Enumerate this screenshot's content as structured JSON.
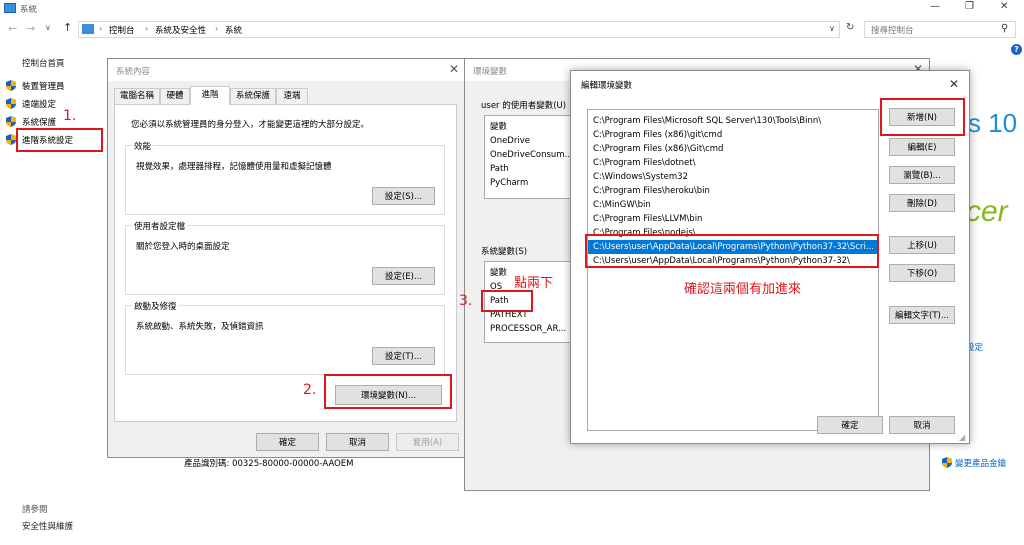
{
  "window": {
    "title": "系統",
    "controls": [
      "—",
      "❐",
      "✕"
    ]
  },
  "address": {
    "breadcrumbs": [
      "控制台",
      "系統及安全性",
      "系統"
    ],
    "search_placeholder": "搜尋控制台"
  },
  "sidebar": {
    "home": "控制台首頁",
    "items": [
      "裝置管理員",
      "遠端設定",
      "系統保護",
      "進階系統設定"
    ],
    "see_also": "請參閱",
    "bottom_link": "安全性與維護"
  },
  "main": {
    "product_id": "產品識別碼: 00325-80000-00000-AAOEM",
    "change_key": "變更產品金鑰",
    "fragment_settings": "設定",
    "fragment_logo1": "s 10",
    "fragment_logo2": "cer",
    "help_icon": "?"
  },
  "sys_props": {
    "title": "系統內容",
    "tabs": [
      "電腦名稱",
      "硬體",
      "進階",
      "系統保護",
      "遠端"
    ],
    "admin_notice": "您必須以系統管理員的身分登入，才能變更這裡的大部分設定。",
    "perf_label": "效能",
    "perf_desc": "視覺效果，處理器排程，記憶體使用量和虛擬記憶體",
    "perf_button": "設定(S)...",
    "profile_label": "使用者設定檔",
    "profile_desc": "關於您登入時的桌面設定",
    "profile_button": "設定(E)...",
    "startup_label": "啟動及修復",
    "startup_desc": "系統啟動、系統失敗，及偵錯資訊",
    "startup_button": "設定(T)...",
    "env_button": "環境變數(N)...",
    "ok": "確定",
    "cancel": "取消",
    "apply": "套用(A)"
  },
  "env_vars": {
    "title": "環境變數",
    "user_section": "user 的使用者變數(U)",
    "user_header": "變數",
    "user_rows": [
      "OneDrive",
      "OneDriveConsum...",
      "Path",
      "PyCharm"
    ],
    "sys_section": "系統變數(S)",
    "sys_header": "變數",
    "sys_rows": [
      "OS",
      "Path",
      "PATHEXT",
      "PROCESSOR_AR..."
    ]
  },
  "edit_env": {
    "title": "編輯環境變數",
    "paths": [
      "C:\\Program Files\\Microsoft SQL Server\\130\\Tools\\Binn\\",
      "C:\\Program Files (x86)\\git\\cmd",
      "C:\\Program Files (x86)\\Git\\cmd",
      "C:\\Program Files\\dotnet\\",
      "C:\\Windows\\System32",
      "C:\\Program Files\\heroku\\bin",
      "C:\\MinGW\\bin",
      "C:\\Program Files\\LLVM\\bin",
      "C:\\Program Files\\nodejs\\",
      "C:\\Users\\user\\AppData\\Local\\Programs\\Python\\Python37-32\\Scri...",
      "C:\\Users\\user\\AppData\\Local\\Programs\\Python\\Python37-32\\"
    ],
    "selected_index": 9,
    "buttons": [
      "新增(N)",
      "編輯(E)",
      "瀏覽(B)...",
      "刪除(D)",
      "上移(U)",
      "下移(O)",
      "編輯文字(T)..."
    ],
    "ok": "確定",
    "cancel": "取消"
  },
  "annotations": {
    "step1": "1.",
    "step2": "2.",
    "step3": "3.",
    "double_click": "點兩下",
    "confirm": "確認這兩個有加進來"
  },
  "colors": {
    "accent": "#0078d7",
    "annotation_red": "#e0161e",
    "shield_blue": "#1f5fbf",
    "shield_yellow": "#f2b705"
  }
}
